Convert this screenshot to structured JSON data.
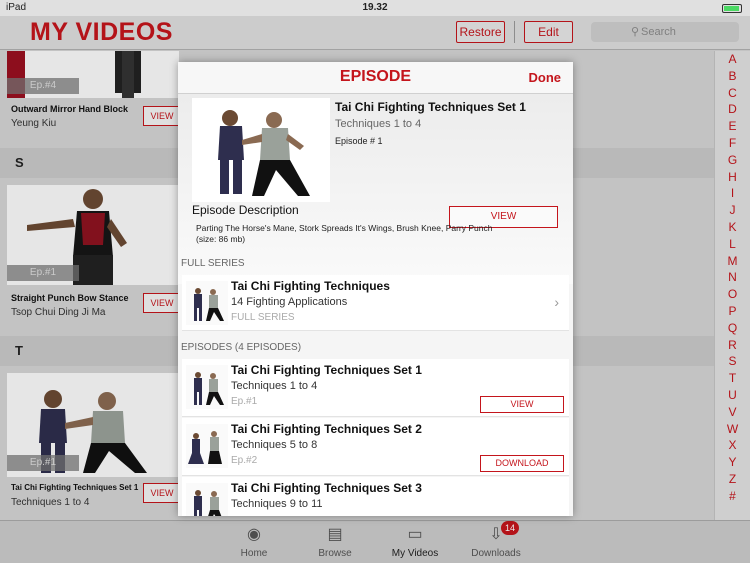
{
  "status_bar": {
    "carrier": "iPad",
    "time": "19.32"
  },
  "header": {
    "title": "MY VIDEOS",
    "restore_label": "Restore",
    "edit_label": "Edit",
    "search_placeholder": "Search"
  },
  "list": {
    "card1": {
      "ep": "Ep.#4",
      "title": "Outward Mirror Hand Block",
      "subtitle": "Yeung Kiu",
      "view": "VIEW"
    },
    "section_s": "S",
    "card2": {
      "ep": "Ep.#1",
      "title": "Straight Punch Bow Stance",
      "subtitle": "Tsop Chui Ding Ji Ma",
      "view": "VIEW"
    },
    "section_t": "T",
    "card3": {
      "ep": "Ep.#1",
      "title": "Tai Chi Fighting Techniques Set 1",
      "subtitle": "Techniques 1 to 4",
      "view": "VIEW"
    }
  },
  "index": [
    "A",
    "B",
    "C",
    "D",
    "E",
    "F",
    "G",
    "H",
    "I",
    "J",
    "K",
    "L",
    "M",
    "N",
    "O",
    "P",
    "Q",
    "R",
    "S",
    "T",
    "U",
    "V",
    "W",
    "X",
    "Y",
    "Z",
    "#"
  ],
  "modal": {
    "title": "EPISODE",
    "done_label": "Done",
    "episode": {
      "title": "Tai Chi Fighting Techniques Set 1",
      "subtitle": "Techniques 1 to 4",
      "number": "Episode # 1",
      "view_label": "VIEW"
    },
    "description_heading": "Episode Description",
    "description_text": "Parting The Horse's Mane, Stork Spreads It's Wings, Brush Knee, Parry Punch",
    "description_size": "(size: 86 mb)",
    "full_series_heading": "FULL SERIES",
    "series": {
      "title": "Tai Chi Fighting Techniques",
      "subtitle": "14 Fighting Applications",
      "tag": "FULL SERIES"
    },
    "episodes_heading": "EPISODES (4 EPISODES)",
    "episodes": [
      {
        "title": "Tai Chi Fighting Techniques Set 1",
        "subtitle": "Techniques 1 to 4",
        "ep": "Ep.#1",
        "action": "VIEW"
      },
      {
        "title": "Tai Chi Fighting Techniques Set 2",
        "subtitle": "Techniques 5 to 8",
        "ep": "Ep.#2",
        "action": "DOWNLOAD"
      },
      {
        "title": "Tai Chi Fighting Techniques Set 3",
        "subtitle": "Techniques 9 to 11",
        "ep": "",
        "action": ""
      }
    ]
  },
  "tabs": [
    {
      "label": "Home",
      "icon": "home-icon"
    },
    {
      "label": "Browse",
      "icon": "browse-icon"
    },
    {
      "label": "My Videos",
      "icon": "my-videos-icon"
    },
    {
      "label": "Downloads",
      "icon": "downloads-icon",
      "badge": "14"
    }
  ],
  "colors": {
    "accent": "#c4151c"
  }
}
